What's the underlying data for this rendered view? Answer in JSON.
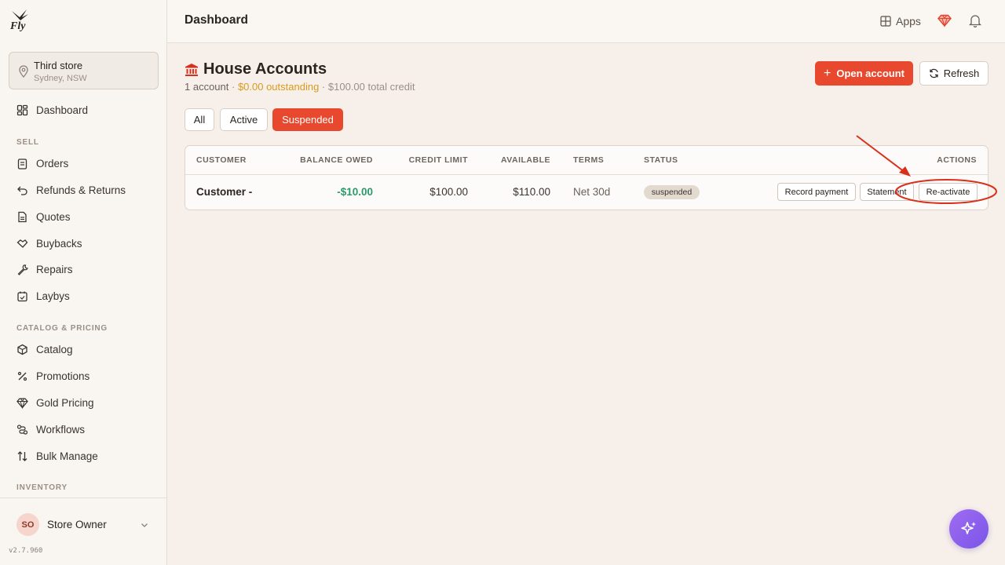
{
  "sidebar": {
    "logo_text": "Fly",
    "store": {
      "name": "Third store",
      "location": "Sydney, NSW"
    },
    "dashboard": "Dashboard",
    "sections": {
      "sell": "SELL",
      "catalog": "CATALOG & PRICING",
      "inventory": "INVENTORY"
    },
    "sell_items": [
      "Orders",
      "Refunds & Returns",
      "Quotes",
      "Buybacks",
      "Repairs",
      "Laybys"
    ],
    "catalog_items": [
      "Catalog",
      "Promotions",
      "Gold Pricing",
      "Workflows",
      "Bulk Manage"
    ],
    "user": {
      "initials": "SO",
      "name": "Store Owner"
    },
    "version": "v2.7.960"
  },
  "header": {
    "title": "Dashboard",
    "apps_label": "Apps"
  },
  "main": {
    "title": "House Accounts",
    "summary": {
      "count": "1 account",
      "sep1": " · ",
      "outstanding": "$0.00 outstanding",
      "sep2": " · ",
      "credit": "$100.00 total credit"
    },
    "open_account_label": "Open account",
    "refresh_label": "Refresh",
    "filters": [
      "All",
      "Active",
      "Suspended"
    ],
    "active_filter": "Suspended"
  },
  "table": {
    "columns": [
      "CUSTOMER",
      "BALANCE OWED",
      "CREDIT LIMIT",
      "AVAILABLE",
      "TERMS",
      "STATUS",
      "ACTIONS"
    ],
    "rows": [
      {
        "customer": "Customer -",
        "balance": "-$10.00",
        "credit_limit": "$100.00",
        "available": "$110.00",
        "terms": "Net 30d",
        "status": "suspended",
        "actions": [
          "Record payment",
          "Statement",
          "Re-activate"
        ]
      }
    ]
  },
  "colors": {
    "accent": "#e8492e",
    "positive": "#2a9a6a",
    "warning": "#d99a1a",
    "annotation": "#d9301c",
    "ai_button": "#8a60ee"
  },
  "icons": {
    "store": "map-pin-icon",
    "apps": "grid-icon",
    "gem": "gem-icon",
    "bell": "bell-icon",
    "title": "bank-icon",
    "ai": "sparkles-icon"
  }
}
